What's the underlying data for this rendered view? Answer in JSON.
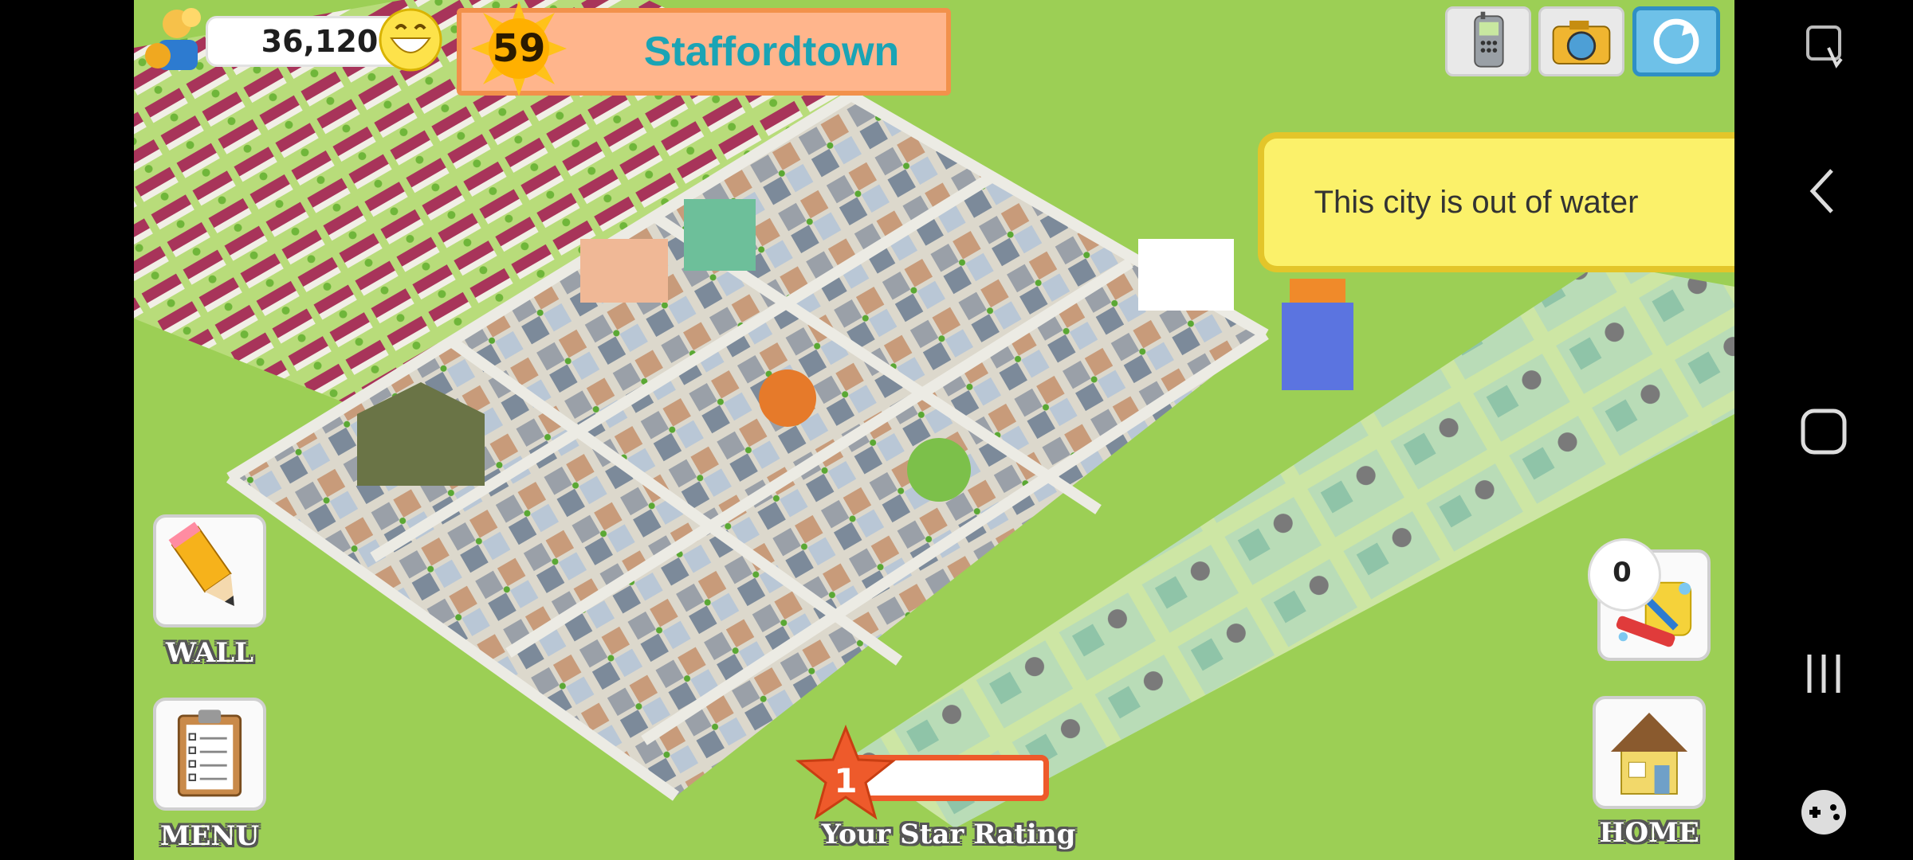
{
  "hud": {
    "coins": "36,120",
    "level": "59",
    "city_name": "Staffordtown",
    "notice": "This city is out of water",
    "clean_count": "0",
    "star_rating": "1",
    "star_progress": 0.0
  },
  "labels": {
    "wall": "WALL",
    "menu": "MENU",
    "home": "HOME",
    "star": "Your Star Rating"
  },
  "icons": {
    "phone": "mobile-phone-icon",
    "camera": "camera-icon",
    "share": "share-icon",
    "wall": "pencil-icon",
    "menu": "clipboard-icon",
    "home": "house-icon",
    "clean": "mop-bucket-icon"
  },
  "colors": {
    "grass": "#9ccf55",
    "road": "#e4e4de",
    "title_text": "#1aa4b5",
    "notice_bg": "#fbf16a",
    "star": "#ee5a2b"
  }
}
